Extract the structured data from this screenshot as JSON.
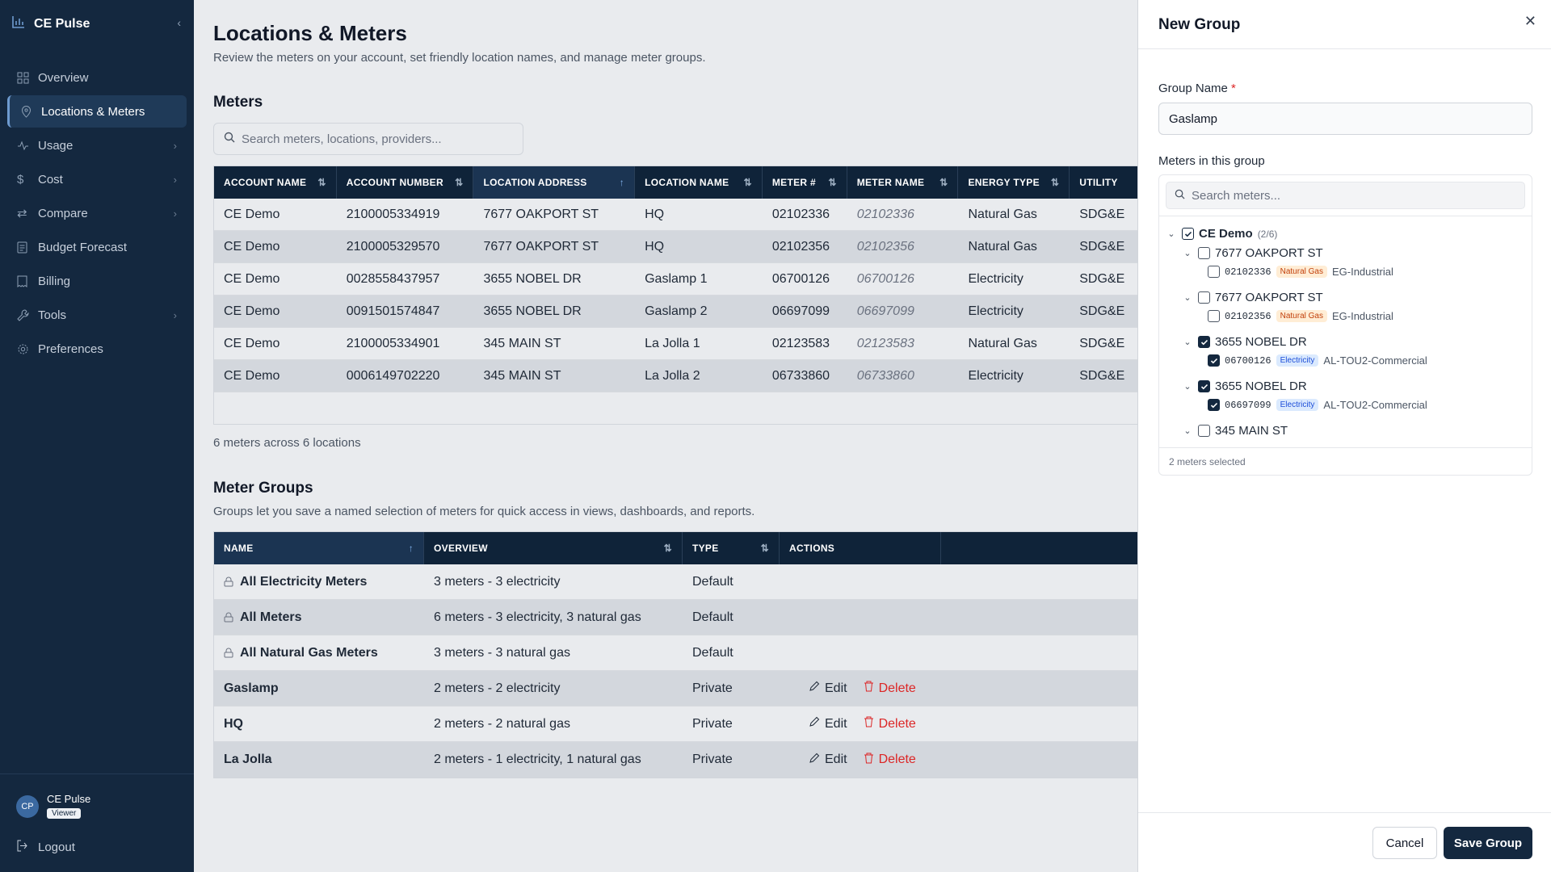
{
  "app": {
    "title": "CE Pulse"
  },
  "sidebar": {
    "items": [
      {
        "label": "Overview"
      },
      {
        "label": "Locations & Meters"
      },
      {
        "label": "Usage"
      },
      {
        "label": "Cost"
      },
      {
        "label": "Compare"
      },
      {
        "label": "Budget Forecast"
      },
      {
        "label": "Billing"
      },
      {
        "label": "Tools"
      },
      {
        "label": "Preferences"
      }
    ],
    "user": {
      "initials": "CP",
      "name": "CE Pulse",
      "role": "Viewer"
    },
    "logout": "Logout"
  },
  "page": {
    "title": "Locations & Meters",
    "subtitle": "Review the meters on your account, set friendly location names, and manage meter groups."
  },
  "meters": {
    "title": "Meters",
    "search_placeholder": "Search meters, locations, providers...",
    "columns": [
      "ACCOUNT NAME",
      "ACCOUNT NUMBER",
      "LOCATION ADDRESS",
      "LOCATION NAME",
      "METER #",
      "METER NAME",
      "ENERGY TYPE",
      "UTILITY"
    ],
    "rows": [
      [
        "CE Demo",
        "2100005334919",
        "7677 OAKPORT ST",
        "HQ",
        "02102336",
        "02102336",
        "Natural Gas",
        "SDG&E"
      ],
      [
        "CE Demo",
        "2100005329570",
        "7677 OAKPORT ST",
        "HQ",
        "02102356",
        "02102356",
        "Natural Gas",
        "SDG&E"
      ],
      [
        "CE Demo",
        "0028558437957",
        "3655 NOBEL DR",
        "Gaslamp 1",
        "06700126",
        "06700126",
        "Electricity",
        "SDG&E"
      ],
      [
        "CE Demo",
        "0091501574847",
        "3655 NOBEL DR",
        "Gaslamp 2",
        "06697099",
        "06697099",
        "Electricity",
        "SDG&E"
      ],
      [
        "CE Demo",
        "2100005334901",
        "345 MAIN ST",
        "La Jolla 1",
        "02123583",
        "02123583",
        "Natural Gas",
        "SDG&E"
      ],
      [
        "CE Demo",
        "0006149702220",
        "345 MAIN ST",
        "La Jolla 2",
        "06733860",
        "06733860",
        "Electricity",
        "SDG&E"
      ]
    ],
    "count": "6 meters across 6 locations"
  },
  "groups": {
    "title": "Meter Groups",
    "subtitle": "Groups let you save a named selection of meters for quick access in views, dashboards, and reports.",
    "columns": [
      "NAME",
      "OVERVIEW",
      "TYPE",
      "ACTIONS"
    ],
    "rows": [
      {
        "name": "All Electricity Meters",
        "overview": "3 meters - 3 electricity",
        "type": "Default"
      },
      {
        "name": "All Meters",
        "overview": "6 meters - 3 electricity, 3 natural gas",
        "type": "Default"
      },
      {
        "name": "All Natural Gas Meters",
        "overview": "3 meters - 3 natural gas",
        "type": "Default"
      },
      {
        "name": "Gaslamp",
        "overview": "2 meters - 2 electricity",
        "type": "Private"
      },
      {
        "name": "HQ",
        "overview": "2 meters - 2 natural gas",
        "type": "Private"
      },
      {
        "name": "La Jolla",
        "overview": "2 meters - 1 electricity, 1 natural gas",
        "type": "Private"
      }
    ],
    "edit_label": "Edit",
    "delete_label": "Delete"
  },
  "panel": {
    "title": "New Group",
    "group_name_label": "Group Name",
    "required_mark": "*",
    "group_name_value": "Gaslamp",
    "meters_label": "Meters in this group",
    "search_placeholder": "Search meters...",
    "account": {
      "name": "CE Demo",
      "count": "(2/6)"
    },
    "locations": [
      {
        "address": "7677 OAKPORT ST",
        "meter": "02102336",
        "type": "Natural Gas",
        "rate": "EG-Industrial",
        "checked": false
      },
      {
        "address": "7677 OAKPORT ST",
        "meter": "02102356",
        "type": "Natural Gas",
        "rate": "EG-Industrial",
        "checked": false
      },
      {
        "address": "3655 NOBEL DR",
        "meter": "06700126",
        "type": "Electricity",
        "rate": "AL-TOU2-Commercial",
        "checked": true
      },
      {
        "address": "3655 NOBEL DR",
        "meter": "06697099",
        "type": "Electricity",
        "rate": "AL-TOU2-Commercial",
        "checked": true
      },
      {
        "address": "345 MAIN ST"
      }
    ],
    "selected_count": "2 meters selected",
    "cancel": "Cancel",
    "save": "Save Group"
  }
}
